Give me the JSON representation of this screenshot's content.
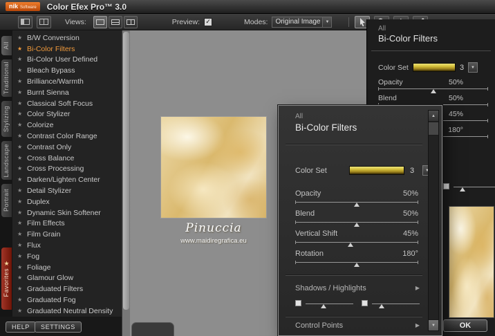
{
  "icons": {
    "star": "★",
    "favorites_star": "★",
    "check": "✓",
    "chevron_down": "▼",
    "scroll_up": "▲",
    "scroll_down": "▼",
    "expander_right": "▶"
  },
  "titlebar": {
    "logo_primary": "nik",
    "logo_secondary": "Software",
    "title": "Color Efex Pro™ 3.0"
  },
  "toolbar": {
    "views_label": "Views:",
    "preview_label": "Preview:",
    "modes_label": "Modes:",
    "modes_value": "Original Image"
  },
  "category_tabs": [
    {
      "label": "All"
    },
    {
      "label": "Traditional"
    },
    {
      "label": "Stylizing"
    },
    {
      "label": "Landscape"
    },
    {
      "label": "Portrait"
    },
    {
      "label": "Favorites"
    }
  ],
  "filters": {
    "items": [
      {
        "label": "B/W Conversion"
      },
      {
        "label": "Bi-Color Filters",
        "selected": true
      },
      {
        "label": "Bi-Color User Defined"
      },
      {
        "label": "Bleach Bypass"
      },
      {
        "label": "Brilliance/Warmth"
      },
      {
        "label": "Burnt Sienna"
      },
      {
        "label": "Classical Soft Focus"
      },
      {
        "label": "Color Stylizer"
      },
      {
        "label": "Colorize"
      },
      {
        "label": "Contrast Color Range"
      },
      {
        "label": "Contrast Only"
      },
      {
        "label": "Cross Balance"
      },
      {
        "label": "Cross Processing"
      },
      {
        "label": "Darken/Lighten Center"
      },
      {
        "label": "Detail Stylizer"
      },
      {
        "label": "Duplex"
      },
      {
        "label": "Dynamic Skin Softener"
      },
      {
        "label": "Film Effects"
      },
      {
        "label": "Film Grain"
      },
      {
        "label": "Flux"
      },
      {
        "label": "Fog"
      },
      {
        "label": "Foliage"
      },
      {
        "label": "Glamour Glow"
      },
      {
        "label": "Graduated Filters"
      },
      {
        "label": "Graduated Fog"
      },
      {
        "label": "Graduated Neutral Density"
      }
    ]
  },
  "canvas": {
    "caption": "Pinuccia",
    "caption_url": "www.maidiregrafica.eu"
  },
  "dock_panel": {
    "category_label": "All",
    "title": "Bi-Color Filters",
    "color_set_label": "Color Set",
    "color_set_value": "3",
    "sliders": [
      {
        "label": "Opacity",
        "value": "50%",
        "pos": 50
      },
      {
        "label": "Blend",
        "value": "50%",
        "pos": 50
      },
      {
        "label": "Vertical Shift",
        "value": "45%",
        "pos": 45
      },
      {
        "label": "Rotation",
        "value": "180°",
        "pos": 50
      }
    ],
    "shadow_sliders": [
      {
        "pos": 38
      },
      {
        "pos": 20
      }
    ],
    "ok_label": "OK"
  },
  "float_panel": {
    "category_label": "All",
    "title": "Bi-Color Filters",
    "color_set_label": "Color Set",
    "color_set_value": "3",
    "sliders": [
      {
        "label": "Opacity",
        "value": "50%",
        "pos": 50
      },
      {
        "label": "Blend",
        "value": "50%",
        "pos": 50
      },
      {
        "label": "Vertical Shift",
        "value": "45%",
        "pos": 45
      },
      {
        "label": "Rotation",
        "value": "180°",
        "pos": 50
      }
    ],
    "shadows_label": "Shadows / Highlights",
    "control_points_label": "Control Points",
    "shadow_sliders": [
      {
        "pos": 38
      },
      {
        "pos": 20
      }
    ]
  },
  "footer": {
    "help_label": "HELP",
    "settings_label": "SETTINGS"
  },
  "colors": {
    "accent_orange": "#f09a3c",
    "favorites_red": "#8e2015",
    "gold": "#d9b96e",
    "canvas_gray": "#8d8d8d"
  }
}
